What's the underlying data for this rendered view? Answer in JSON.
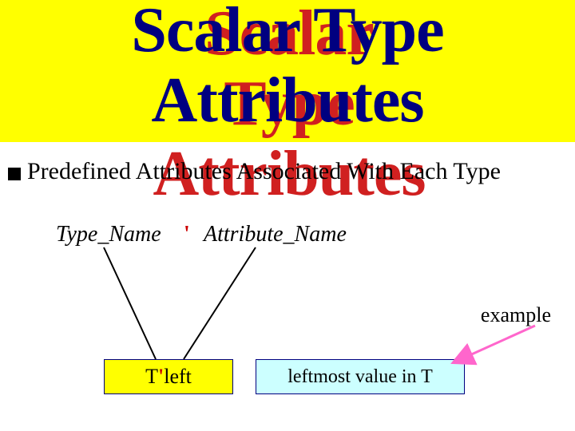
{
  "title": {
    "line1": "Scalar Type",
    "line2": "Attributes"
  },
  "bullet": {
    "text": "Predefined Attributes Associated With Each Type"
  },
  "syntax": {
    "type_name": "Type_Name",
    "tick": "'",
    "attribute_name": "Attribute_Name"
  },
  "example": {
    "label": "example",
    "left_pre": "T",
    "left_tick": "'",
    "left_post": "left",
    "right": "leftmost value in T"
  }
}
